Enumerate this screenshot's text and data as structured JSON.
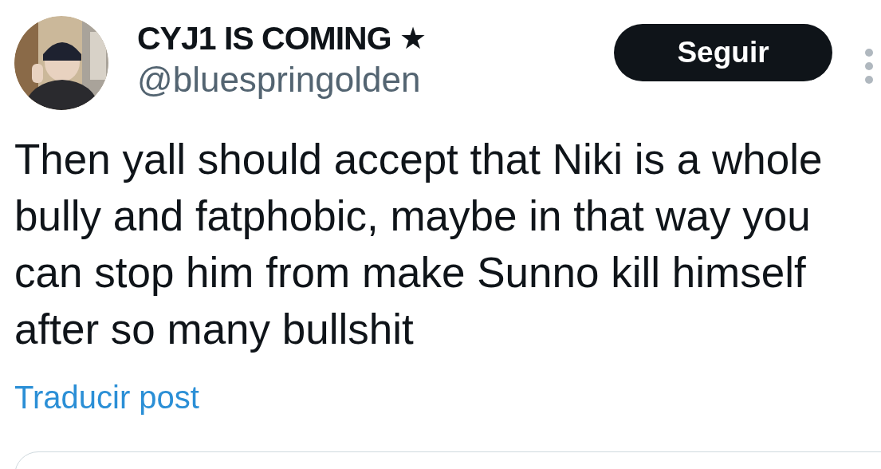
{
  "author": {
    "name": "CYJ1 IS COMING",
    "badge": "★",
    "handle": "@bluespringolden"
  },
  "follow_button": "Seguir",
  "post": {
    "text": "Then yall should accept that Niki is a whole bully and fatphobic, maybe in that way you can stop him from make Sunno kill himself after so many bullshit"
  },
  "translate_link": "Traducir post"
}
